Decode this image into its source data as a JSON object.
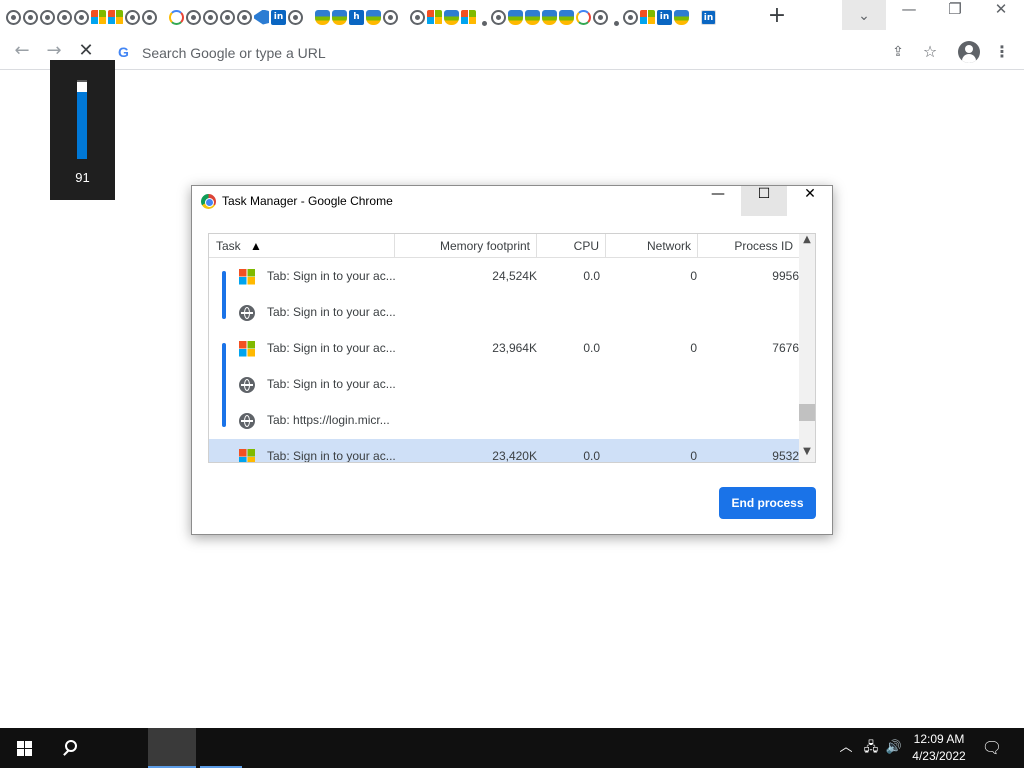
{
  "browser": {
    "new_tab_label": "+",
    "tab_search_icon": "chevron-down-icon",
    "window_controls": {
      "minimize": "—",
      "restore": "❐",
      "close": "✕"
    },
    "toolbar": {
      "back": "←",
      "forward": "→",
      "stop": "✕",
      "omnibox_logo": "G",
      "omnibox_placeholder": "Search Google or type a URL"
    }
  },
  "volume_osd": {
    "level": 91,
    "level_text": "91"
  },
  "task_manager": {
    "title": "Task Manager - Google Chrome",
    "controls": {
      "minimize": "—",
      "maximize": "☐",
      "close": "✕"
    },
    "columns": {
      "task": "Task",
      "sort_indicator": "▲",
      "memory": "Memory footprint",
      "cpu": "CPU",
      "network": "Network",
      "pid": "Process ID"
    },
    "rows": [
      {
        "icon": "microsoft-logo",
        "task": "Tab: Sign in to your ac...",
        "memory": "24,524K",
        "cpu": "0.0",
        "network": "0",
        "pid": "9956"
      },
      {
        "icon": "globe-icon",
        "task": "Tab: Sign in to your ac...",
        "memory": "",
        "cpu": "",
        "network": "",
        "pid": ""
      },
      {
        "icon": "microsoft-logo",
        "task": "Tab: Sign in to your ac...",
        "memory": "23,964K",
        "cpu": "0.0",
        "network": "0",
        "pid": "7676"
      },
      {
        "icon": "globe-icon",
        "task": "Tab: Sign in to your ac...",
        "memory": "",
        "cpu": "",
        "network": "",
        "pid": ""
      },
      {
        "icon": "globe-icon",
        "task": "Tab: https://login.micr...",
        "memory": "",
        "cpu": "",
        "network": "",
        "pid": ""
      },
      {
        "icon": "microsoft-logo",
        "task": "Tab: Sign in to your ac...",
        "memory": "23,420K",
        "cpu": "0.0",
        "network": "0",
        "pid": "9532",
        "selected": true
      }
    ],
    "end_process_label": "End process"
  },
  "taskbar": {
    "clock_time": "12:09 AM",
    "clock_date": "4/23/2022",
    "tray": {
      "chevron": "︿",
      "network": "🖧",
      "volume": "🔊"
    },
    "notification_icon": "🗨"
  },
  "colors": {
    "accent": "#1a73e8",
    "selection": "#cfe0f7",
    "taskbar": "#101010",
    "osd_fill": "#0078d7"
  }
}
